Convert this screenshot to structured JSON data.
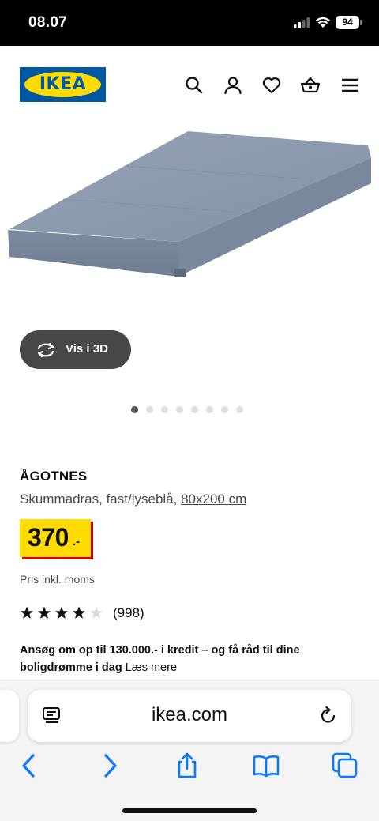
{
  "status_bar": {
    "time": "08.07",
    "battery": "94"
  },
  "header": {
    "logo_text": "IKEA",
    "icons": [
      "search-icon",
      "profile-icon",
      "heart-icon",
      "basket-icon",
      "menu-icon"
    ]
  },
  "gallery": {
    "view_3d_label": "Vis i 3D",
    "dot_count": 8,
    "active_dot": 0
  },
  "product": {
    "name": "ÅGOTNES",
    "description": "Skummadras, fast/lyseblå,",
    "size": "80x200 cm",
    "price_main": "370",
    "price_suffix": ".-",
    "vat_note": "Pris inkl. moms",
    "rating_stars": 4,
    "rating_max": 5,
    "review_count": "(998)",
    "credit_text": "Ansøg om op til 130.000.- i kredit – og få råd til dine boligdrømme i dag",
    "credit_link": "Læs mere"
  },
  "browser": {
    "url": "ikea.com",
    "toolbar_icons": [
      "back-icon",
      "forward-icon",
      "share-icon",
      "bookmarks-icon",
      "tabs-icon"
    ]
  },
  "colors": {
    "ikea_blue": "#0058a3",
    "ikea_yellow": "#ffdb00",
    "price_shadow": "#cc0008",
    "safari_blue": "#0a7aff",
    "mattress": "#8796ab"
  }
}
